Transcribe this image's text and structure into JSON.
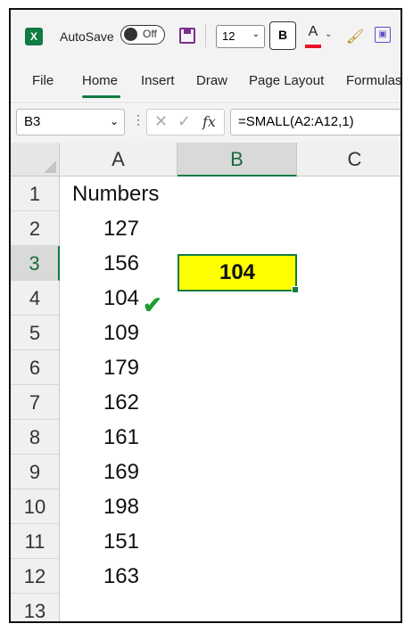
{
  "titlebar": {
    "app_icon": "X",
    "autosave_label": "AutoSave",
    "autosave_state": "Off",
    "font_size": "12",
    "bold_label": "B",
    "font_color_label": "A",
    "font_color_bar": "#e81123"
  },
  "ribbon": {
    "tabs": [
      "File",
      "Home",
      "Insert",
      "Draw",
      "Page Layout",
      "Formulas"
    ],
    "active_tab": "Home"
  },
  "formula_bar": {
    "name_box": "B3",
    "fx_label": "fx",
    "formula": "=SMALL(A2:A12,1)"
  },
  "sheet": {
    "columns": [
      "A",
      "B",
      "C"
    ],
    "selected_column": "B",
    "rows": [
      "1",
      "2",
      "3",
      "4",
      "5",
      "6",
      "7",
      "8",
      "9",
      "10",
      "11",
      "12",
      "13"
    ],
    "selected_row": "3",
    "column_a": {
      "header": "Numbers",
      "values": [
        "127",
        "156",
        "104",
        "109",
        "179",
        "162",
        "161",
        "169",
        "198",
        "151",
        "163"
      ]
    },
    "b3_value": "104",
    "highlight_color": "#ffff00",
    "check_icon": "check-mark-icon"
  }
}
